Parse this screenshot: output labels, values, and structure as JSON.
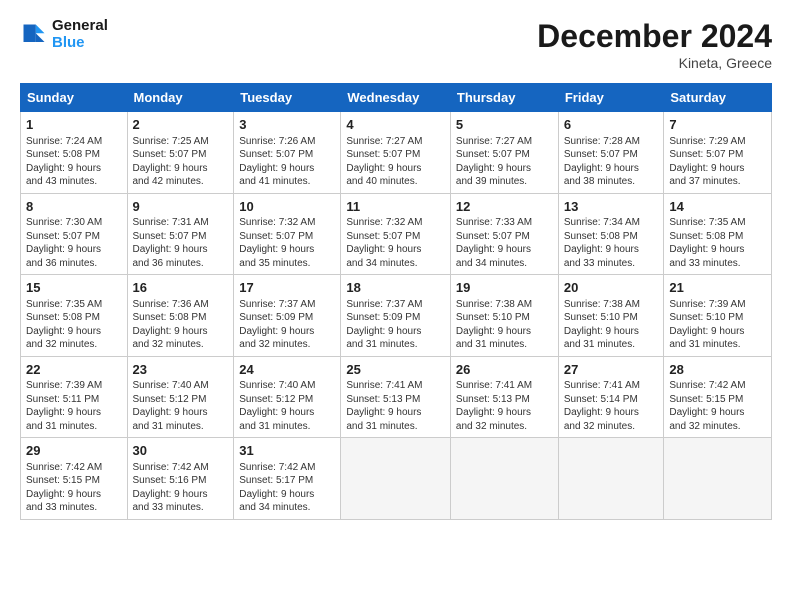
{
  "header": {
    "logo_line1": "General",
    "logo_line2": "Blue",
    "title": "December 2024",
    "subtitle": "Kineta, Greece"
  },
  "days_of_week": [
    "Sunday",
    "Monday",
    "Tuesday",
    "Wednesday",
    "Thursday",
    "Friday",
    "Saturday"
  ],
  "weeks": [
    [
      {
        "day": "1",
        "info": "Sunrise: 7:24 AM\nSunset: 5:08 PM\nDaylight: 9 hours\nand 43 minutes."
      },
      {
        "day": "2",
        "info": "Sunrise: 7:25 AM\nSunset: 5:07 PM\nDaylight: 9 hours\nand 42 minutes."
      },
      {
        "day": "3",
        "info": "Sunrise: 7:26 AM\nSunset: 5:07 PM\nDaylight: 9 hours\nand 41 minutes."
      },
      {
        "day": "4",
        "info": "Sunrise: 7:27 AM\nSunset: 5:07 PM\nDaylight: 9 hours\nand 40 minutes."
      },
      {
        "day": "5",
        "info": "Sunrise: 7:27 AM\nSunset: 5:07 PM\nDaylight: 9 hours\nand 39 minutes."
      },
      {
        "day": "6",
        "info": "Sunrise: 7:28 AM\nSunset: 5:07 PM\nDaylight: 9 hours\nand 38 minutes."
      },
      {
        "day": "7",
        "info": "Sunrise: 7:29 AM\nSunset: 5:07 PM\nDaylight: 9 hours\nand 37 minutes."
      }
    ],
    [
      {
        "day": "8",
        "info": "Sunrise: 7:30 AM\nSunset: 5:07 PM\nDaylight: 9 hours\nand 36 minutes."
      },
      {
        "day": "9",
        "info": "Sunrise: 7:31 AM\nSunset: 5:07 PM\nDaylight: 9 hours\nand 36 minutes."
      },
      {
        "day": "10",
        "info": "Sunrise: 7:32 AM\nSunset: 5:07 PM\nDaylight: 9 hours\nand 35 minutes."
      },
      {
        "day": "11",
        "info": "Sunrise: 7:32 AM\nSunset: 5:07 PM\nDaylight: 9 hours\nand 34 minutes."
      },
      {
        "day": "12",
        "info": "Sunrise: 7:33 AM\nSunset: 5:07 PM\nDaylight: 9 hours\nand 34 minutes."
      },
      {
        "day": "13",
        "info": "Sunrise: 7:34 AM\nSunset: 5:08 PM\nDaylight: 9 hours\nand 33 minutes."
      },
      {
        "day": "14",
        "info": "Sunrise: 7:35 AM\nSunset: 5:08 PM\nDaylight: 9 hours\nand 33 minutes."
      }
    ],
    [
      {
        "day": "15",
        "info": "Sunrise: 7:35 AM\nSunset: 5:08 PM\nDaylight: 9 hours\nand 32 minutes."
      },
      {
        "day": "16",
        "info": "Sunrise: 7:36 AM\nSunset: 5:08 PM\nDaylight: 9 hours\nand 32 minutes."
      },
      {
        "day": "17",
        "info": "Sunrise: 7:37 AM\nSunset: 5:09 PM\nDaylight: 9 hours\nand 32 minutes."
      },
      {
        "day": "18",
        "info": "Sunrise: 7:37 AM\nSunset: 5:09 PM\nDaylight: 9 hours\nand 31 minutes."
      },
      {
        "day": "19",
        "info": "Sunrise: 7:38 AM\nSunset: 5:10 PM\nDaylight: 9 hours\nand 31 minutes."
      },
      {
        "day": "20",
        "info": "Sunrise: 7:38 AM\nSunset: 5:10 PM\nDaylight: 9 hours\nand 31 minutes."
      },
      {
        "day": "21",
        "info": "Sunrise: 7:39 AM\nSunset: 5:10 PM\nDaylight: 9 hours\nand 31 minutes."
      }
    ],
    [
      {
        "day": "22",
        "info": "Sunrise: 7:39 AM\nSunset: 5:11 PM\nDaylight: 9 hours\nand 31 minutes."
      },
      {
        "day": "23",
        "info": "Sunrise: 7:40 AM\nSunset: 5:12 PM\nDaylight: 9 hours\nand 31 minutes."
      },
      {
        "day": "24",
        "info": "Sunrise: 7:40 AM\nSunset: 5:12 PM\nDaylight: 9 hours\nand 31 minutes."
      },
      {
        "day": "25",
        "info": "Sunrise: 7:41 AM\nSunset: 5:13 PM\nDaylight: 9 hours\nand 31 minutes."
      },
      {
        "day": "26",
        "info": "Sunrise: 7:41 AM\nSunset: 5:13 PM\nDaylight: 9 hours\nand 32 minutes."
      },
      {
        "day": "27",
        "info": "Sunrise: 7:41 AM\nSunset: 5:14 PM\nDaylight: 9 hours\nand 32 minutes."
      },
      {
        "day": "28",
        "info": "Sunrise: 7:42 AM\nSunset: 5:15 PM\nDaylight: 9 hours\nand 32 minutes."
      }
    ],
    [
      {
        "day": "29",
        "info": "Sunrise: 7:42 AM\nSunset: 5:15 PM\nDaylight: 9 hours\nand 33 minutes."
      },
      {
        "day": "30",
        "info": "Sunrise: 7:42 AM\nSunset: 5:16 PM\nDaylight: 9 hours\nand 33 minutes."
      },
      {
        "day": "31",
        "info": "Sunrise: 7:42 AM\nSunset: 5:17 PM\nDaylight: 9 hours\nand 34 minutes."
      },
      null,
      null,
      null,
      null
    ]
  ]
}
